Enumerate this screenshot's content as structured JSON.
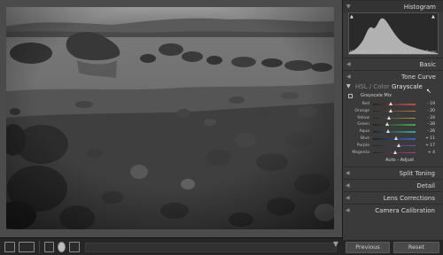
{
  "panel": {
    "histogram": "Histogram",
    "histogram_labels": [
      "ISO 100",
      "12 mm",
      "f / 10",
      "5 sec"
    ],
    "basic": "Basic",
    "tone_curve": "Tone Curve",
    "hsl_label": "HSL / Color",
    "grayscale_label": "Grayscale",
    "grayscale_mix_title": "Grayscale Mix",
    "mix": [
      {
        "label": "Red",
        "value": "- 19",
        "pos": 0.42,
        "color": "#c05050"
      },
      {
        "label": "Orange",
        "value": "- 20",
        "pos": 0.42,
        "color": "#c08040"
      },
      {
        "label": "Yellow",
        "value": "- 24",
        "pos": 0.38,
        "color": "#b0a040"
      },
      {
        "label": "Green",
        "value": "- 28",
        "pos": 0.34,
        "color": "#50a050"
      },
      {
        "label": "Aqua",
        "value": "- 26",
        "pos": 0.36,
        "color": "#40a0a0"
      },
      {
        "label": "Blue",
        "value": "+ 11",
        "pos": 0.55,
        "color": "#4060c0"
      },
      {
        "label": "Purple",
        "value": "+ 17",
        "pos": 0.6,
        "color": "#8050b0"
      },
      {
        "label": "Magenta",
        "value": "+ 4",
        "pos": 0.52,
        "color": "#b04090"
      }
    ],
    "auto_adjust": "Auto - Adjust",
    "split_toning": "Split Toning",
    "detail": "Detail",
    "lens_corrections": "Lens Corrections",
    "camera_calibration": "Camera Calibration"
  },
  "buttons": {
    "previous": "Previous",
    "reset": "Reset"
  }
}
